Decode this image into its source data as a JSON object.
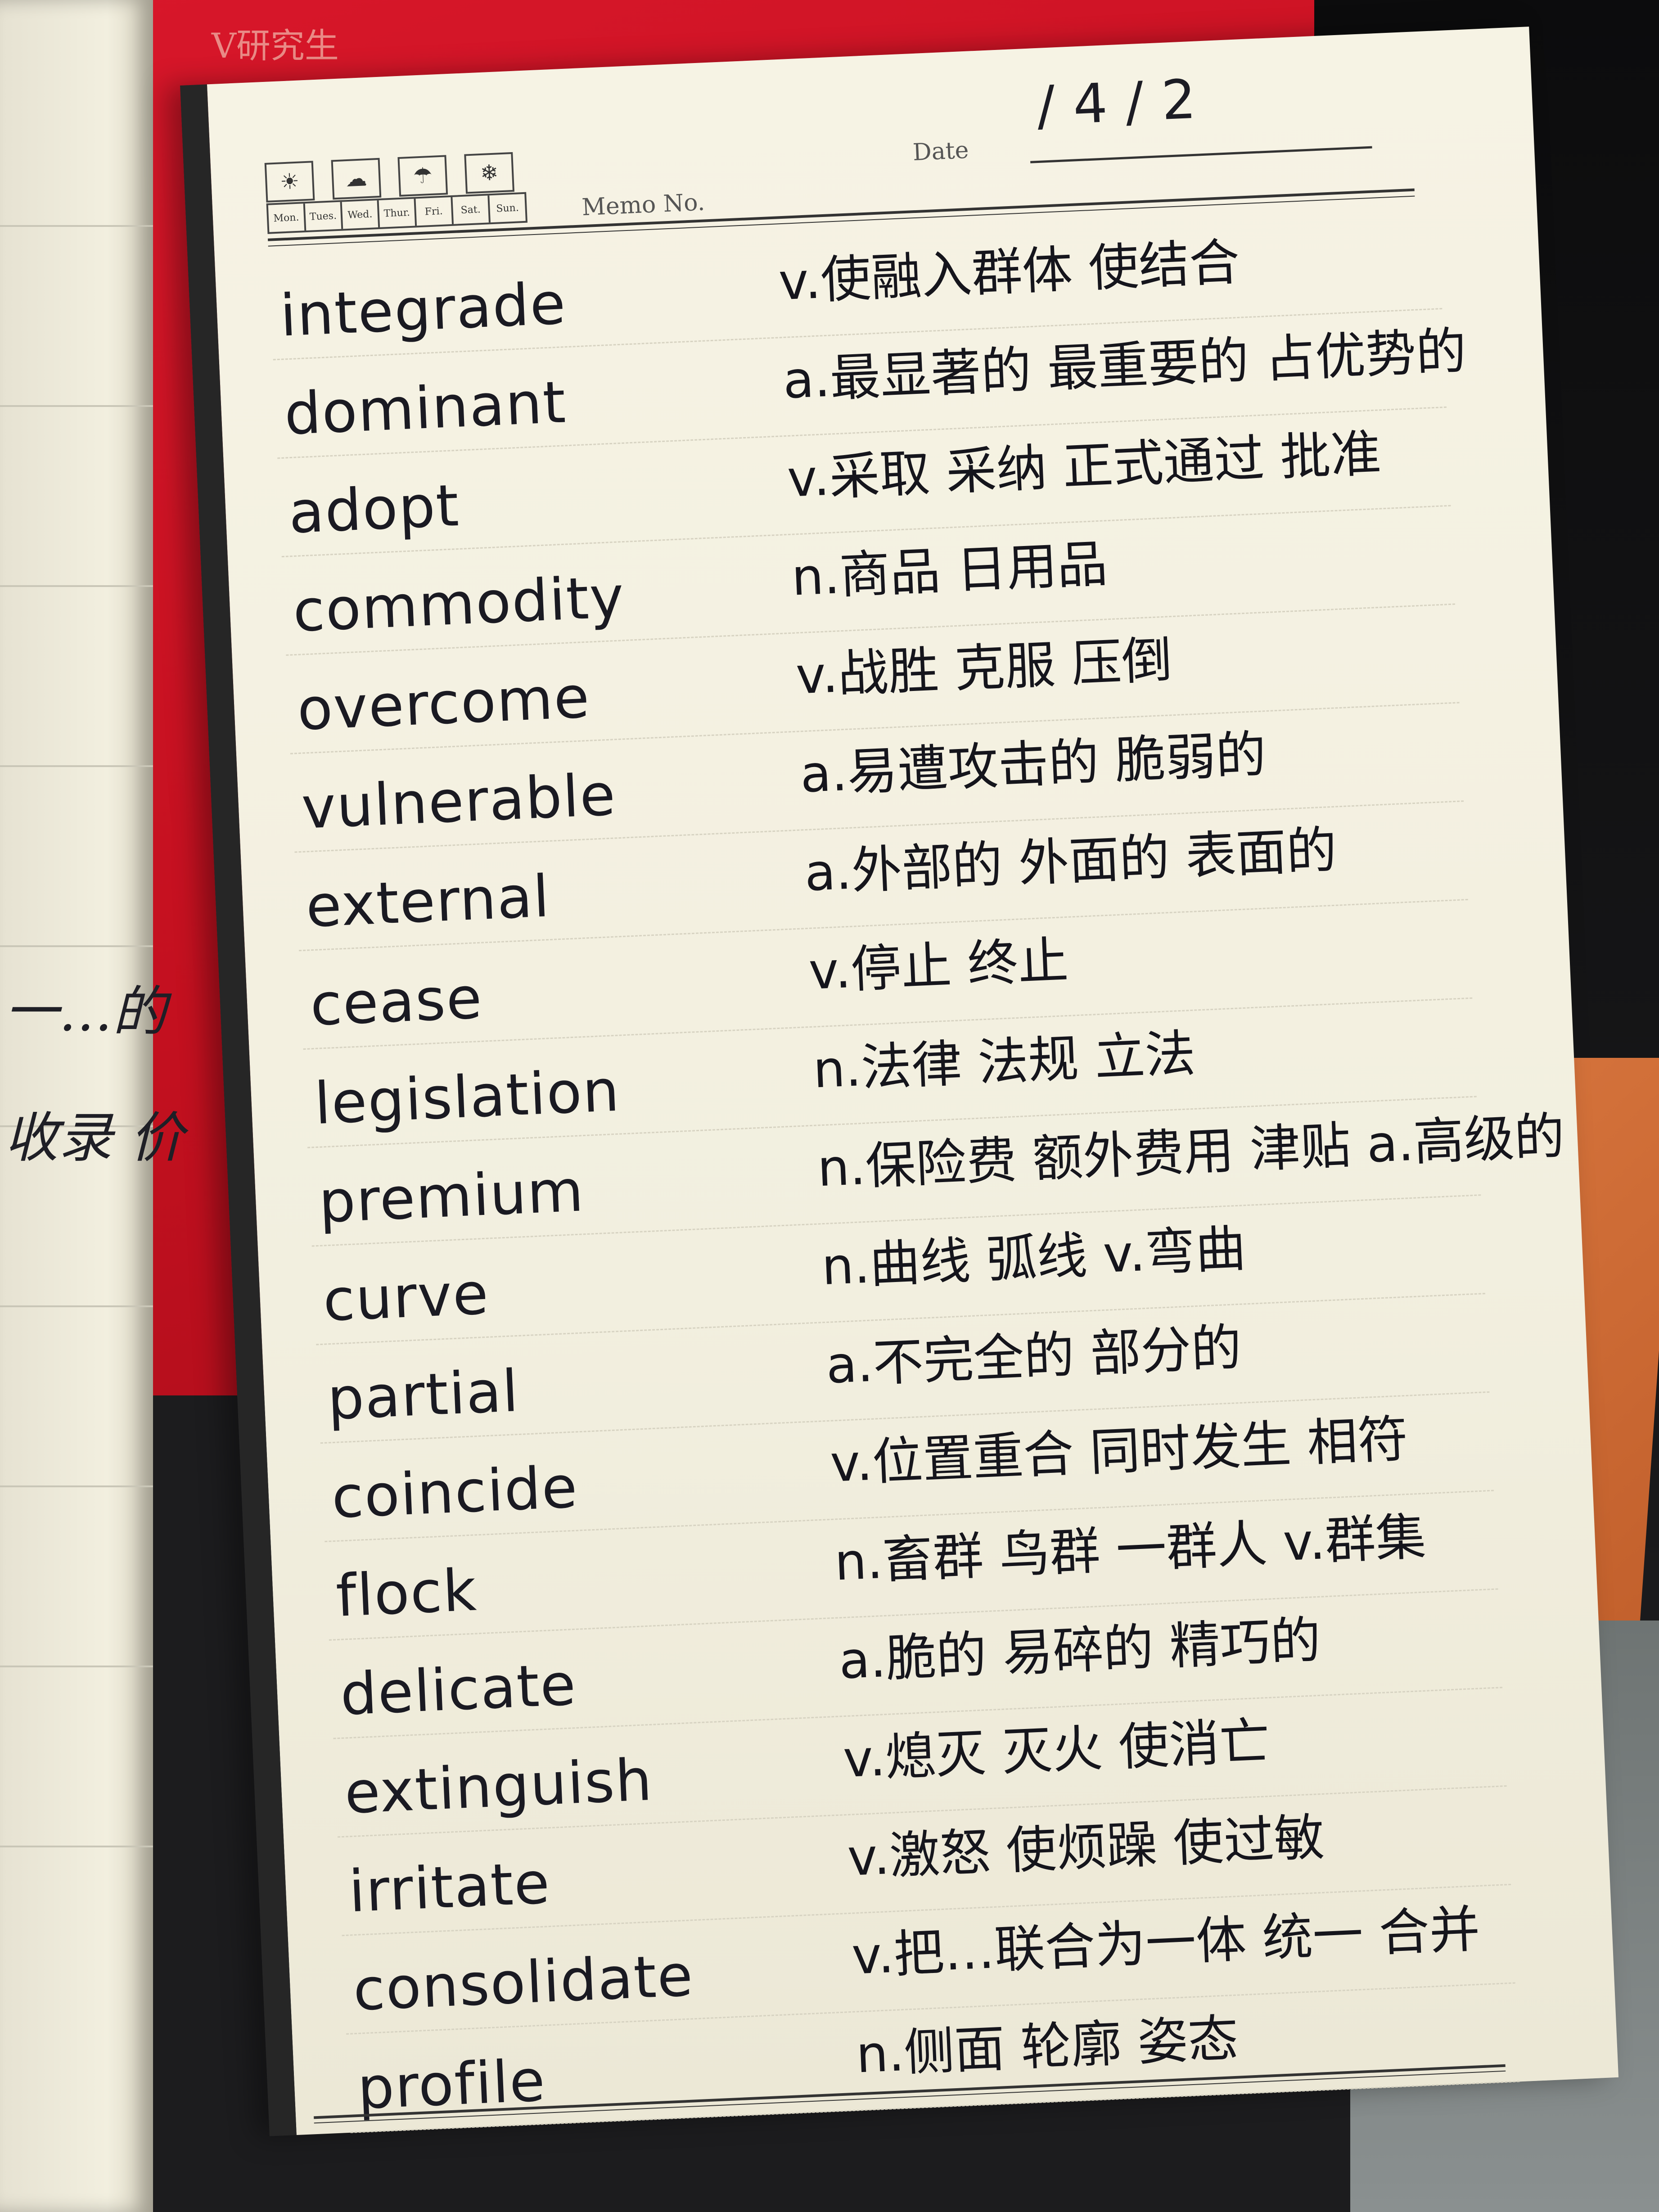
{
  "background_banner": "V研究生",
  "left_page_fragments": [
    "一…的",
    "收录 价"
  ],
  "header": {
    "day_labels": [
      "Mon.",
      "Tues.",
      "Wed.",
      "Thur.",
      "Fri.",
      "Sat.",
      "Sun."
    ],
    "weather_icons": [
      "sun-icon",
      "cloud-icon",
      "umbrella-icon",
      "snow-icon"
    ],
    "memo_label": "Memo No.",
    "date_label": "Date",
    "date_value": "/4/2"
  },
  "entries": [
    {
      "word": "integrade",
      "meaning": "v.使融入群体 使结合"
    },
    {
      "word": "dominant",
      "meaning": "a.最显著的 最重要的 占优势的"
    },
    {
      "word": "adopt",
      "meaning": "v.采取 采纳 正式通过 批准"
    },
    {
      "word": "commodity",
      "meaning": "n.商品 日用品"
    },
    {
      "word": "overcome",
      "meaning": "v.战胜 克服 压倒"
    },
    {
      "word": "vulnerable",
      "meaning": "a.易遭攻击的 脆弱的"
    },
    {
      "word": "external",
      "meaning": "a.外部的 外面的 表面的"
    },
    {
      "word": "cease",
      "meaning": "v.停止 终止"
    },
    {
      "word": "legislation",
      "meaning": "n.法律 法规 立法"
    },
    {
      "word": "premium",
      "meaning": "n.保险费 额外费用 津贴 a.高级的"
    },
    {
      "word": "curve",
      "meaning": "n.曲线 弧线 v.弯曲"
    },
    {
      "word": "partial",
      "meaning": "a.不完全的 部分的"
    },
    {
      "word": "coincide",
      "meaning": "v.位置重合 同时发生 相符"
    },
    {
      "word": "flock",
      "meaning": "n.畜群 鸟群 一群人 v.群集"
    },
    {
      "word": "delicate",
      "meaning": "a.脆的 易碎的 精巧的"
    },
    {
      "word": "extinguish",
      "meaning": "v.熄灭 灭火 使消亡"
    },
    {
      "word": "irritate",
      "meaning": "v.激怒 使烦躁 使过敏"
    },
    {
      "word": "consolidate",
      "meaning": "v.把…联合为一体 统一 合并"
    },
    {
      "word": "profile",
      "meaning": "n.侧面 轮廓 姿态"
    }
  ]
}
